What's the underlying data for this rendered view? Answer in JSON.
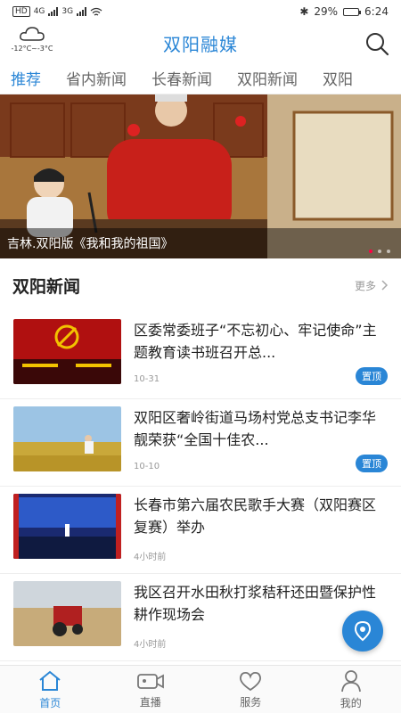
{
  "status_bar": {
    "left_labels": [
      "HD",
      "4G",
      "3G"
    ],
    "battery": "29%",
    "time": "6:24"
  },
  "header": {
    "weather_temp": "-12°C~-3°C",
    "title": "双阳融媒"
  },
  "tabs": [
    {
      "label": "推荐"
    },
    {
      "label": "省内新闻"
    },
    {
      "label": "长春新闻"
    },
    {
      "label": "双阳新闻"
    },
    {
      "label": "双阳"
    }
  ],
  "banner": {
    "caption": "吉林.双阳版《我和我的祖国》",
    "dots": 3,
    "active_dot": 0
  },
  "section": {
    "title": "双阳新闻",
    "more_label": "更多"
  },
  "news": [
    {
      "title": "区委常委班子“不忘初心、牢记使命”主题教育读书班召开总...",
      "time": "10-31",
      "pin": "置顶"
    },
    {
      "title": "双阳区奢岭街道马场村党总支书记李华靓荣获“全国十佳农...",
      "time": "10-10",
      "pin": "置顶"
    },
    {
      "title": "长春市第六届农民歌手大赛（双阳赛区复赛）举办",
      "time": "4小时前",
      "pin": ""
    },
    {
      "title": "我区召开水田秋打浆秸秆还田暨保护性耕作现场会",
      "time": "4小时前",
      "pin": ""
    }
  ],
  "bottom_nav": [
    {
      "label": "首页",
      "icon": "home-icon"
    },
    {
      "label": "直播",
      "icon": "video-camera-icon"
    },
    {
      "label": "服务",
      "icon": "heart-icon"
    },
    {
      "label": "我的",
      "icon": "user-icon"
    }
  ],
  "colors": {
    "accent": "#2a86d6",
    "banner_dot_active": "#ff0044"
  }
}
